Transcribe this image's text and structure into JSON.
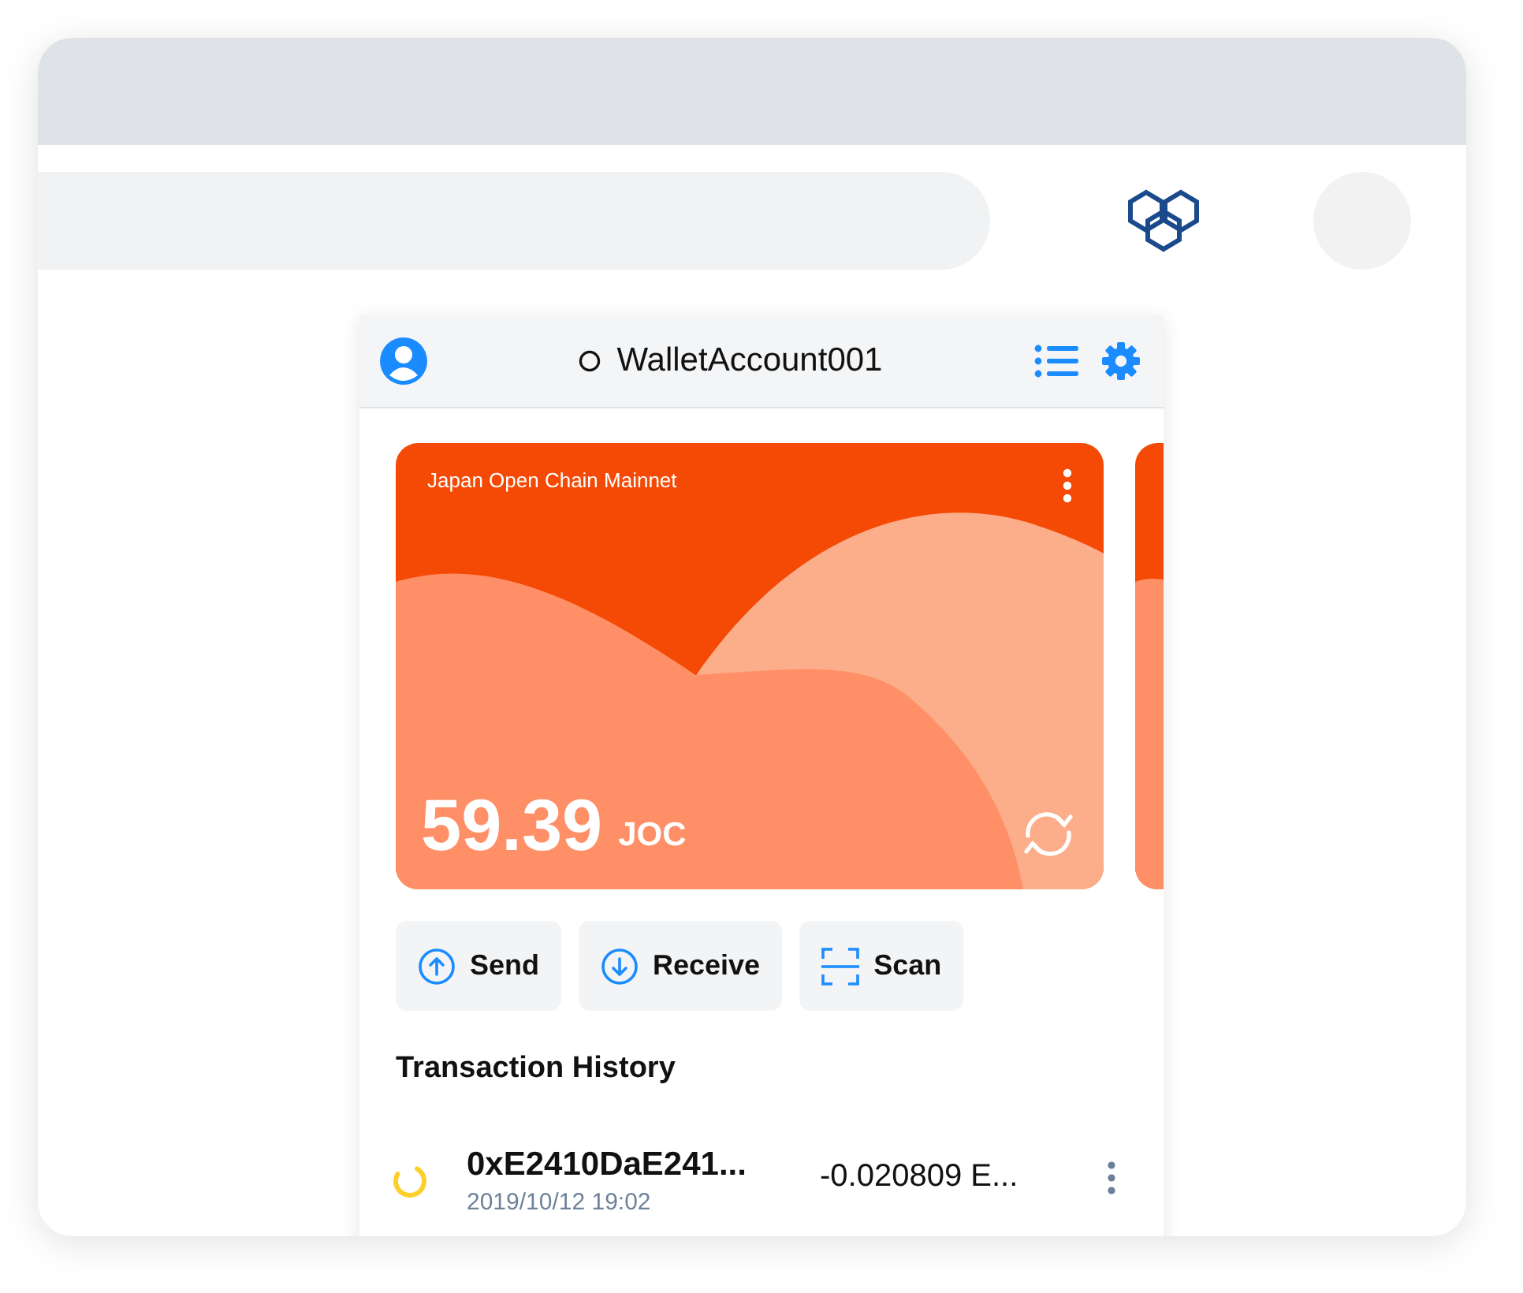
{
  "header": {
    "account": "WalletAccount001"
  },
  "card": {
    "network": "Japan Open Chain Mainnet",
    "balance": "59.39",
    "unit": "JOC"
  },
  "actions": [
    {
      "kind": "send",
      "label": "Send"
    },
    {
      "kind": "receive",
      "label": "Receive"
    },
    {
      "kind": "scan",
      "label": "Scan"
    }
  ],
  "history": {
    "title": "Transaction History",
    "transactions": [
      {
        "pending": true,
        "address": "0xE2410DaE241...",
        "time": "2019/10/12 19:02",
        "amount": "-0.020809 E..."
      }
    ]
  }
}
